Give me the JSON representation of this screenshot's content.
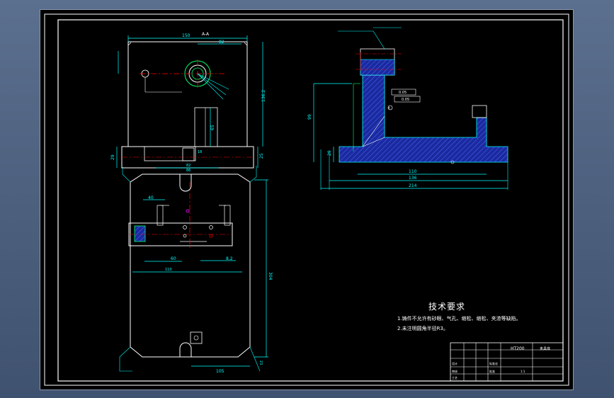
{
  "tech_requirements": {
    "title": "技术要求",
    "lines": [
      "1.铸件不允许有砂眼、气孔、缩松、缩松、夹渣等缺陷。",
      "2.未注明圆角半径R3。"
    ]
  },
  "dimensions": {
    "top_width": "150",
    "top_inner": "82",
    "height_right": "136.2",
    "h_left": "29",
    "h_right": "25",
    "inner_h": "65",
    "bottom_off": "18",
    "bottom_w": "82",
    "bottom_w2": "86",
    "plan_total_h": "304",
    "plan_dim_40": "40",
    "plan_dim_60": "60",
    "plan_dim_8_2": "8.2",
    "plan_dim_110": "110",
    "plan_dim_105": "105",
    "plan_dim_23": "23",
    "side_h": "99",
    "side_left_h": "29",
    "side_width_110": "110",
    "side_width_136": "136",
    "side_total": "214",
    "tol_1": "0.05",
    "tol_2": "0.05"
  },
  "labels": {
    "section_mark": "A-A",
    "label_A": "A"
  },
  "title_block": {
    "material": "HT200",
    "rows": [
      "设计",
      "审核",
      "工艺",
      "标准化",
      "批准"
    ],
    "part_name": "夹具体",
    "scale": "1:1"
  },
  "colors": {
    "background": "#000000",
    "outline": "#ffffff",
    "dim_line": "#00ffff",
    "center_line": "#ff0000",
    "section_fill": "#1a2a9e",
    "hatch": "#4f68ff",
    "dim_text": "#00ff66"
  }
}
